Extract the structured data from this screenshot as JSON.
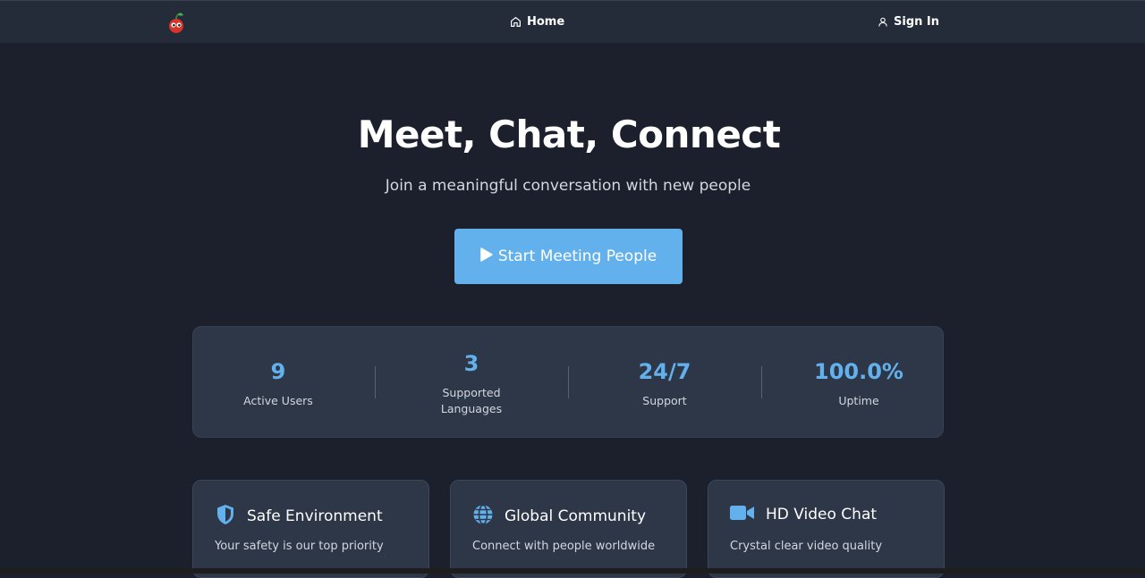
{
  "nav": {
    "logo_icon": "cherry-logo-icon",
    "home_label": "Home",
    "home_icon": "home-icon",
    "signin_label": "Sign In",
    "signin_icon": "user-icon"
  },
  "hero": {
    "title": "Meet, Chat, Connect",
    "subtitle": "Join a meaningful conversation with new people",
    "cta_label": "Start Meeting People",
    "cta_icon": "play-icon"
  },
  "stats": [
    {
      "value": "9",
      "label": "Active Users"
    },
    {
      "value": "3",
      "label": "Supported Languages"
    },
    {
      "value": "24/7",
      "label": "Support"
    },
    {
      "value": "100.0%",
      "label": "Uptime"
    }
  ],
  "features": [
    {
      "icon": "shield-icon",
      "title": "Safe Environment",
      "desc": "Your safety is our top priority"
    },
    {
      "icon": "globe-icon",
      "title": "Global Community",
      "desc": "Connect with people worldwide"
    },
    {
      "icon": "video-camera-icon",
      "title": "HD Video Chat",
      "desc": "Crystal clear video quality"
    }
  ],
  "colors": {
    "background": "#1b202c",
    "navbar": "#242c39",
    "accent": "#63b1ec",
    "panel": "#2d3747"
  }
}
